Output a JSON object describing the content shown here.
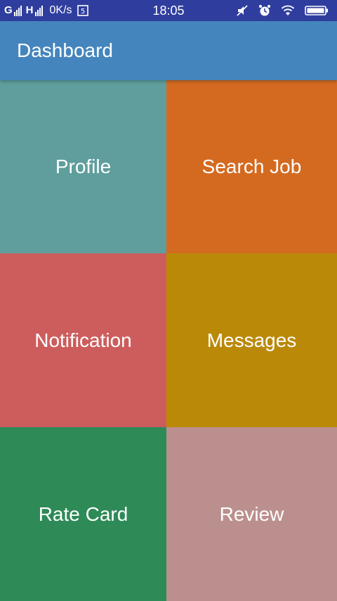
{
  "status_bar": {
    "signal1_letter": "G",
    "signal2_letter": "H",
    "network_speed": "0K/s",
    "time": "18:05",
    "icons": [
      "sim-card-icon",
      "mute-icon",
      "alarm-icon",
      "wifi-icon",
      "battery-icon"
    ]
  },
  "app_bar": {
    "title": "Dashboard"
  },
  "tiles": [
    {
      "label": "Profile",
      "color": "#5f9e9c"
    },
    {
      "label": "Search Job",
      "color": "#d46a20"
    },
    {
      "label": "Notification",
      "color": "#cd5d5d"
    },
    {
      "label": "Messages",
      "color": "#ba8908"
    },
    {
      "label": "Rate Card",
      "color": "#2e8a57"
    },
    {
      "label": "Review",
      "color": "#bc8f8f"
    }
  ],
  "colors": {
    "status_bar": "#2f3e9e",
    "app_bar": "#4585bd"
  }
}
